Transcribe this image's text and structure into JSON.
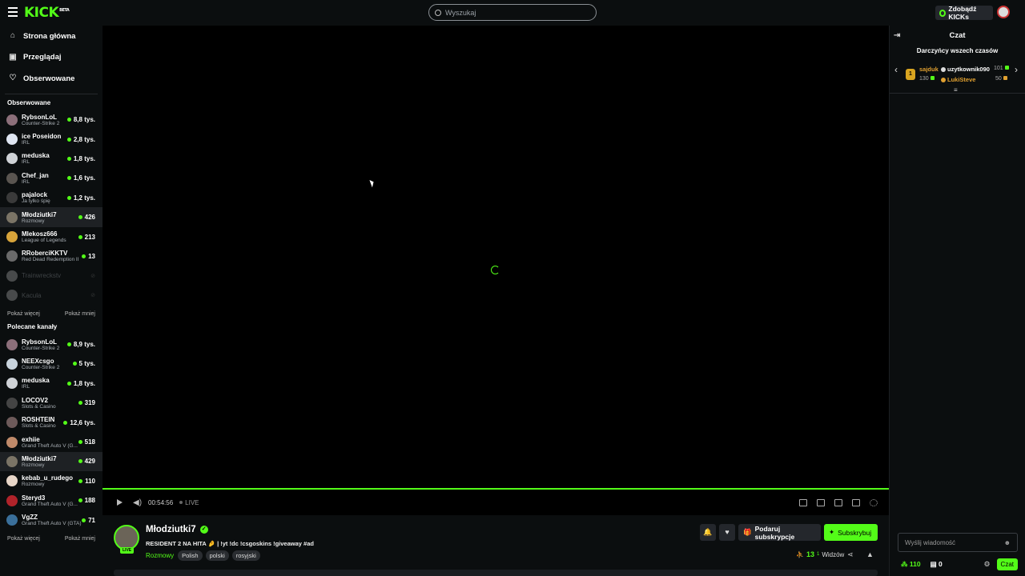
{
  "header": {
    "logo": "KICK",
    "logo_badge": "BETA",
    "search_placeholder": "Wyszukaj",
    "get_kicks": "Zdobądź KICKs"
  },
  "nav": {
    "home": "Strona główna",
    "browse": "Przeglądaj",
    "following": "Obserwowane"
  },
  "followed": {
    "title": "Obserwowane",
    "channels": [
      {
        "name": "RybsonLoL",
        "category": "Counter-Strike 2",
        "viewers": "8,8 tys.",
        "color": "#8c6f7a"
      },
      {
        "name": "ice Poseidon",
        "category": "IRL",
        "viewers": "2,8 tys.",
        "color": "#dfe6f2"
      },
      {
        "name": "meduska",
        "category": "IRL",
        "viewers": "1,8 tys.",
        "color": "#cfd2d6"
      },
      {
        "name": "Chef_jan",
        "category": "IRL",
        "viewers": "1,6 tys.",
        "color": "#5a5550"
      },
      {
        "name": "pajalock",
        "category": "Ja tylko śpię",
        "viewers": "1,2 tys.",
        "color": "#3a3a3a"
      },
      {
        "name": "Młodziutki7",
        "category": "Rozmowy",
        "viewers": "426",
        "color": "#7b7466"
      },
      {
        "name": "Mlekosz666",
        "category": "League of Legends",
        "viewers": "213",
        "color": "#d8a43a"
      },
      {
        "name": "RRoberciKKTV",
        "category": "Red Dead Redemption II",
        "viewers": "13",
        "color": "#6a6a6a"
      },
      {
        "name": "Trainwreckstv",
        "category": "",
        "viewers": "",
        "color": "#bbbbbb"
      },
      {
        "name": "Kacula",
        "category": "",
        "viewers": "",
        "color": "#bbbbbb"
      }
    ],
    "show_more": "Pokaż więcej",
    "show_less": "Pokaż mniej"
  },
  "recommended": {
    "title": "Polecane kanały",
    "channels": [
      {
        "name": "RybsonLoL",
        "category": "Counter-Strike 2",
        "viewers": "8,9 tys.",
        "color": "#8c6f7a"
      },
      {
        "name": "NEEXcsgo",
        "category": "Counter-Strike 2",
        "viewers": "5 tys.",
        "color": "#c8d3dc"
      },
      {
        "name": "meduska",
        "category": "IRL",
        "viewers": "1,8 tys.",
        "color": "#cfd2d6"
      },
      {
        "name": "LOCOV2",
        "category": "Slots & Casino",
        "viewers": "319",
        "color": "#444444"
      },
      {
        "name": "ROSHTEIN",
        "category": "Slots & Casino",
        "viewers": "12,6 tys.",
        "color": "#6d5a5a"
      },
      {
        "name": "exhiie",
        "category": "Grand Theft Auto V (G...",
        "viewers": "518",
        "color": "#c08a6a"
      },
      {
        "name": "Młodziutki7",
        "category": "Rozmowy",
        "viewers": "429",
        "color": "#7b7466"
      },
      {
        "name": "kebab_u_rudego",
        "category": "Rozmowy",
        "viewers": "110",
        "color": "#e8d6c8"
      },
      {
        "name": "Steryd3",
        "category": "Grand Theft Auto V (G...",
        "viewers": "188",
        "color": "#b0232a"
      },
      {
        "name": "VgZZ",
        "category": "Grand Theft Auto V (GTA)",
        "viewers": "71",
        "color": "#3a6f9a"
      }
    ],
    "show_more": "Pokaż więcej",
    "show_less": "Pokaż mniej"
  },
  "player": {
    "time": "00:54:56",
    "live": "LIVE"
  },
  "stream": {
    "streamer": "Młodziutki7",
    "live_badge": "LIVE",
    "title": "RESIDENT 2 NA HITA 🤌 | !yt !dc !csgoskins !giveaway #ad",
    "category": "Rozmowy",
    "tags": [
      "Polish",
      "polski",
      "rosyjski"
    ],
    "gift_sub": "Podaruj subskrypcje",
    "subscribe": "Subskrybuj",
    "viewers_count": "13",
    "viewers_sup": "1",
    "viewers_label": "Widzów"
  },
  "chat": {
    "title": "Czat",
    "gifters_title": "Darczyńcy wszech czasów",
    "gifters": [
      {
        "rank": "1",
        "name": "sajduk",
        "amount": "130"
      },
      {
        "name": "uzytkownik090",
        "amount": "101"
      },
      {
        "name": "LukiSteve",
        "amount": "50"
      }
    ],
    "input_placeholder": "Wyślij wiadomość",
    "points": "110",
    "gifts": "0",
    "chat_button": "Czat"
  },
  "colors": {
    "accent": "#53fc18",
    "background": "#0b0e0f",
    "player": "#000000"
  }
}
